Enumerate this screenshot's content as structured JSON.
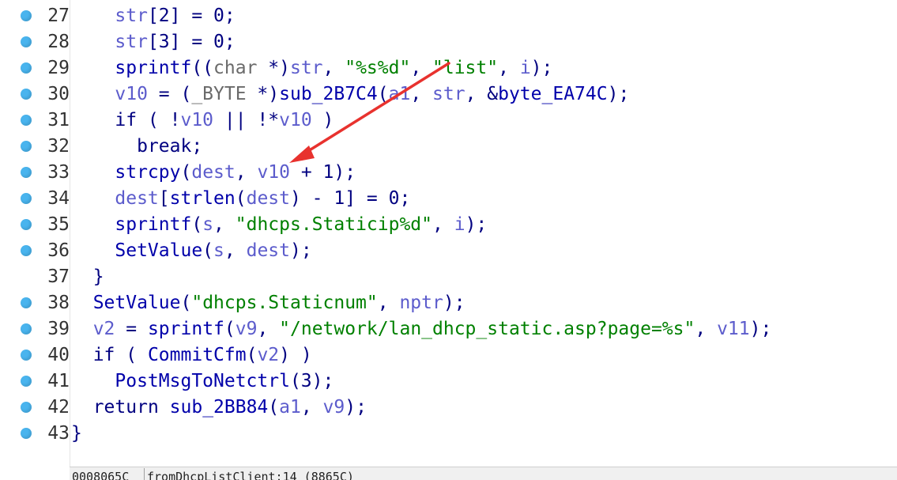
{
  "editor": {
    "lines": [
      {
        "num": "27",
        "tokens": [
          {
            "t": "    ",
            "c": "tok-punc"
          },
          {
            "t": "str",
            "c": "tok-var"
          },
          {
            "t": "[2] = 0;",
            "c": "tok-punc"
          }
        ]
      },
      {
        "num": "28",
        "tokens": [
          {
            "t": "    ",
            "c": "tok-punc"
          },
          {
            "t": "str",
            "c": "tok-var"
          },
          {
            "t": "[3] = 0;",
            "c": "tok-punc"
          }
        ]
      },
      {
        "num": "29",
        "tokens": [
          {
            "t": "    ",
            "c": "tok-punc"
          },
          {
            "t": "sprintf",
            "c": "tok-fn"
          },
          {
            "t": "((",
            "c": "tok-punc"
          },
          {
            "t": "char",
            "c": "tok-type"
          },
          {
            "t": " *)",
            "c": "tok-punc"
          },
          {
            "t": "str",
            "c": "tok-var"
          },
          {
            "t": ", ",
            "c": "tok-punc"
          },
          {
            "t": "\"%s%d\"",
            "c": "tok-str"
          },
          {
            "t": ", ",
            "c": "tok-punc"
          },
          {
            "t": "\"list\"",
            "c": "tok-str"
          },
          {
            "t": ", ",
            "c": "tok-punc"
          },
          {
            "t": "i",
            "c": "tok-var"
          },
          {
            "t": ");",
            "c": "tok-punc"
          }
        ]
      },
      {
        "num": "30",
        "tokens": [
          {
            "t": "    ",
            "c": "tok-punc"
          },
          {
            "t": "v10",
            "c": "tok-var"
          },
          {
            "t": " = (",
            "c": "tok-punc"
          },
          {
            "t": "_BYTE",
            "c": "tok-type"
          },
          {
            "t": " *)",
            "c": "tok-punc"
          },
          {
            "t": "sub_2B7C4",
            "c": "tok-fn"
          },
          {
            "t": "(",
            "c": "tok-punc"
          },
          {
            "t": "a1",
            "c": "tok-var"
          },
          {
            "t": ", ",
            "c": "tok-punc"
          },
          {
            "t": "str",
            "c": "tok-var"
          },
          {
            "t": ", &",
            "c": "tok-punc"
          },
          {
            "t": "byte_EA74C",
            "c": "tok-fn"
          },
          {
            "t": ");",
            "c": "tok-punc"
          }
        ]
      },
      {
        "num": "31",
        "tokens": [
          {
            "t": "    ",
            "c": "tok-punc"
          },
          {
            "t": "if",
            "c": "tok-kw"
          },
          {
            "t": " ( !",
            "c": "tok-punc"
          },
          {
            "t": "v10",
            "c": "tok-var"
          },
          {
            "t": " || !*",
            "c": "tok-punc"
          },
          {
            "t": "v10",
            "c": "tok-var"
          },
          {
            "t": " )",
            "c": "tok-punc"
          }
        ]
      },
      {
        "num": "32",
        "tokens": [
          {
            "t": "      ",
            "c": "tok-punc"
          },
          {
            "t": "break",
            "c": "tok-kw"
          },
          {
            "t": ";",
            "c": "tok-punc"
          }
        ]
      },
      {
        "num": "33",
        "tokens": [
          {
            "t": "    ",
            "c": "tok-punc"
          },
          {
            "t": "strcpy",
            "c": "tok-fn"
          },
          {
            "t": "(",
            "c": "tok-punc"
          },
          {
            "t": "dest",
            "c": "tok-var"
          },
          {
            "t": ", ",
            "c": "tok-punc"
          },
          {
            "t": "v10",
            "c": "tok-var"
          },
          {
            "t": " + 1);",
            "c": "tok-punc"
          }
        ]
      },
      {
        "num": "34",
        "tokens": [
          {
            "t": "    ",
            "c": "tok-punc"
          },
          {
            "t": "dest",
            "c": "tok-var"
          },
          {
            "t": "[",
            "c": "tok-punc"
          },
          {
            "t": "strlen",
            "c": "tok-fn"
          },
          {
            "t": "(",
            "c": "tok-punc"
          },
          {
            "t": "dest",
            "c": "tok-var"
          },
          {
            "t": ") - 1] = 0;",
            "c": "tok-punc"
          }
        ]
      },
      {
        "num": "35",
        "tokens": [
          {
            "t": "    ",
            "c": "tok-punc"
          },
          {
            "t": "sprintf",
            "c": "tok-fn"
          },
          {
            "t": "(",
            "c": "tok-punc"
          },
          {
            "t": "s",
            "c": "tok-var"
          },
          {
            "t": ", ",
            "c": "tok-punc"
          },
          {
            "t": "\"dhcps.Staticip%d\"",
            "c": "tok-str"
          },
          {
            "t": ", ",
            "c": "tok-punc"
          },
          {
            "t": "i",
            "c": "tok-var"
          },
          {
            "t": ");",
            "c": "tok-punc"
          }
        ]
      },
      {
        "num": "36",
        "tokens": [
          {
            "t": "    ",
            "c": "tok-punc"
          },
          {
            "t": "SetValue",
            "c": "tok-fn"
          },
          {
            "t": "(",
            "c": "tok-punc"
          },
          {
            "t": "s",
            "c": "tok-var"
          },
          {
            "t": ", ",
            "c": "tok-punc"
          },
          {
            "t": "dest",
            "c": "tok-var"
          },
          {
            "t": ");",
            "c": "tok-punc"
          }
        ]
      },
      {
        "num": "37",
        "noBp": true,
        "tokens": [
          {
            "t": "  }",
            "c": "tok-punc"
          }
        ]
      },
      {
        "num": "38",
        "tokens": [
          {
            "t": "  ",
            "c": "tok-punc"
          },
          {
            "t": "SetValue",
            "c": "tok-fn"
          },
          {
            "t": "(",
            "c": "tok-punc"
          },
          {
            "t": "\"dhcps.Staticnum\"",
            "c": "tok-str"
          },
          {
            "t": ", ",
            "c": "tok-punc"
          },
          {
            "t": "nptr",
            "c": "tok-var"
          },
          {
            "t": ");",
            "c": "tok-punc"
          }
        ]
      },
      {
        "num": "39",
        "tokens": [
          {
            "t": "  ",
            "c": "tok-punc"
          },
          {
            "t": "v2",
            "c": "tok-var"
          },
          {
            "t": " = ",
            "c": "tok-punc"
          },
          {
            "t": "sprintf",
            "c": "tok-fn"
          },
          {
            "t": "(",
            "c": "tok-punc"
          },
          {
            "t": "v9",
            "c": "tok-var"
          },
          {
            "t": ", ",
            "c": "tok-punc"
          },
          {
            "t": "\"/network/lan_dhcp_static.asp?page=%s\"",
            "c": "tok-str"
          },
          {
            "t": ", ",
            "c": "tok-punc"
          },
          {
            "t": "v11",
            "c": "tok-var"
          },
          {
            "t": ");",
            "c": "tok-punc"
          }
        ]
      },
      {
        "num": "40",
        "tokens": [
          {
            "t": "  ",
            "c": "tok-punc"
          },
          {
            "t": "if",
            "c": "tok-kw"
          },
          {
            "t": " ( ",
            "c": "tok-punc"
          },
          {
            "t": "CommitCfm",
            "c": "tok-fn"
          },
          {
            "t": "(",
            "c": "tok-punc"
          },
          {
            "t": "v2",
            "c": "tok-var"
          },
          {
            "t": ") )",
            "c": "tok-punc"
          }
        ]
      },
      {
        "num": "41",
        "tokens": [
          {
            "t": "    ",
            "c": "tok-punc"
          },
          {
            "t": "PostMsgToNetctrl",
            "c": "tok-fn"
          },
          {
            "t": "(3);",
            "c": "tok-punc"
          }
        ]
      },
      {
        "num": "42",
        "tokens": [
          {
            "t": "  ",
            "c": "tok-punc"
          },
          {
            "t": "return",
            "c": "tok-kw"
          },
          {
            "t": " ",
            "c": "tok-punc"
          },
          {
            "t": "sub_2BB84",
            "c": "tok-fn"
          },
          {
            "t": "(",
            "c": "tok-punc"
          },
          {
            "t": "a1",
            "c": "tok-var"
          },
          {
            "t": ", ",
            "c": "tok-punc"
          },
          {
            "t": "v9",
            "c": "tok-var"
          },
          {
            "t": ");",
            "c": "tok-punc"
          }
        ]
      },
      {
        "num": "43",
        "tokens": [
          {
            "t": "}",
            "c": "tok-punc"
          }
        ]
      }
    ]
  },
  "statusbar": {
    "address": "0008065C",
    "location": "fromDhcpListClient:14 (8865C)"
  },
  "colors": {
    "breakpoint": "#49b4ee",
    "arrow": "#e8322e"
  }
}
